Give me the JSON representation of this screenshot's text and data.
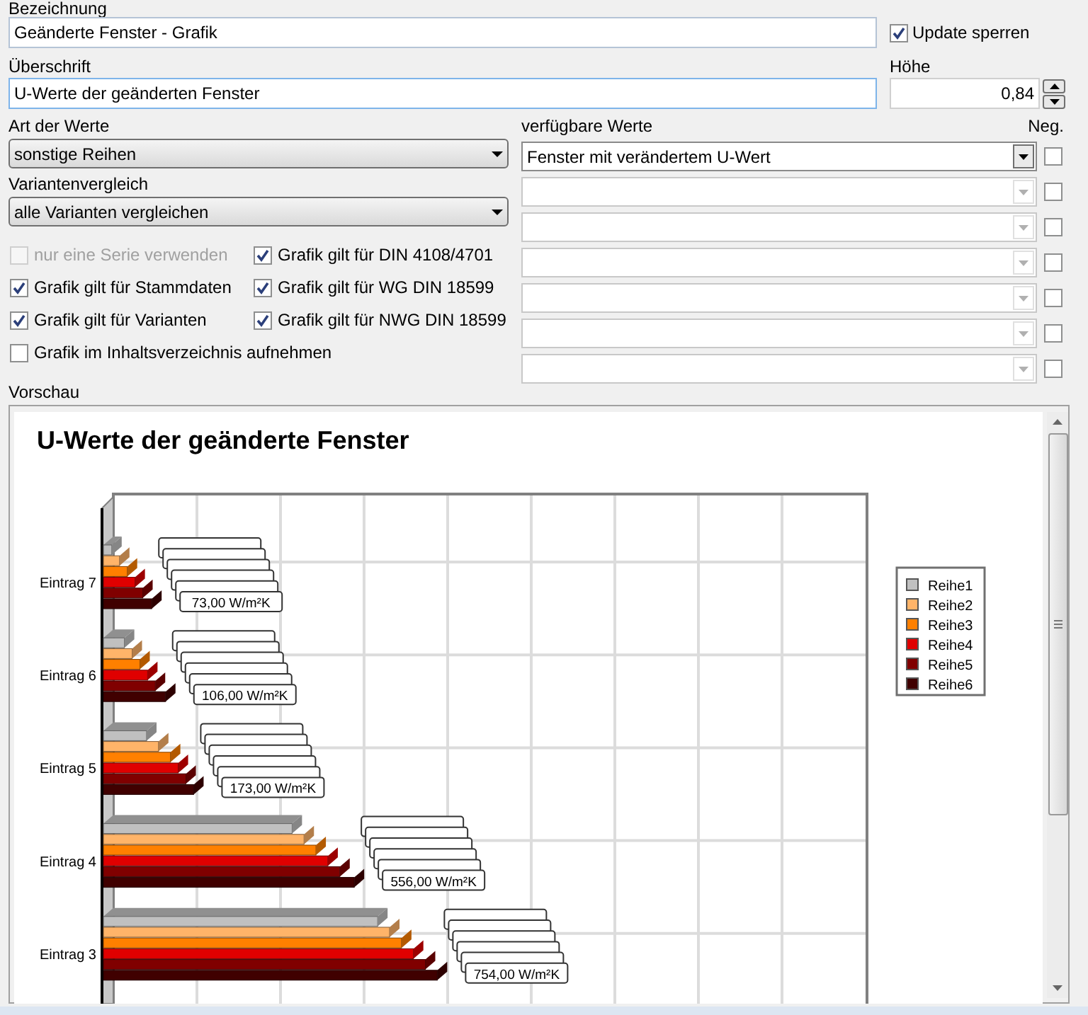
{
  "name": {
    "label": "Bezeichnung",
    "value": "Geänderte Fenster - Grafik"
  },
  "update_lock": {
    "label": "Update sperren",
    "checked": true
  },
  "heading": {
    "label": "Überschrift",
    "value": "U-Werte der geänderten Fenster"
  },
  "height": {
    "label": "Höhe",
    "value": "0,84"
  },
  "value_type": {
    "label": "Art der Werte",
    "value": "sonstige Reihen"
  },
  "variant_compare": {
    "label": "Variantenvergleich",
    "value": "alle Varianten vergleichen"
  },
  "available_values": {
    "label": "verfügbare Werte",
    "neg_label": "Neg.",
    "rows": [
      {
        "value": "Fenster mit verändertem U-Wert",
        "disabled": false,
        "neg": false
      },
      {
        "disabled": true,
        "neg": false
      },
      {
        "disabled": true,
        "neg": false
      },
      {
        "disabled": true,
        "neg": false
      },
      {
        "disabled": true,
        "neg": false
      },
      {
        "disabled": true,
        "neg": false
      },
      {
        "disabled": true,
        "neg": false
      }
    ]
  },
  "options": [
    {
      "label": "nur eine Serie verwenden",
      "checked": false,
      "disabled": true
    },
    {
      "label": "Grafik gilt für DIN 4108/4701",
      "checked": true,
      "disabled": false
    },
    {
      "label": "Grafik gilt für Stammdaten",
      "checked": true,
      "disabled": false
    },
    {
      "label": "Grafik gilt für WG DIN 18599",
      "checked": true,
      "disabled": false
    },
    {
      "label": "Grafik gilt für Varianten",
      "checked": true,
      "disabled": false
    },
    {
      "label": "Grafik gilt für NWG DIN 18599",
      "checked": true,
      "disabled": false
    },
    {
      "label": "Grafik im Inhaltsverzeichnis aufnehmen",
      "checked": false,
      "disabled": false
    }
  ],
  "preview": {
    "label": "Vorschau",
    "chart": {
      "title": "U-Werte der geänderte Fenster",
      "categories": [
        "Eintrag 7",
        "Eintrag 6",
        "Eintrag 5",
        "Eintrag 4",
        "Eintrag 3"
      ],
      "series": [
        {
          "name": "Reihe1",
          "color": "#c0c0c0"
        },
        {
          "name": "Reihe2",
          "color": "#ffb469"
        },
        {
          "name": "Reihe3",
          "color": "#ff8000"
        },
        {
          "name": "Reihe4",
          "color": "#e00000"
        },
        {
          "name": "Reihe5",
          "color": "#800000"
        },
        {
          "name": "Reihe6",
          "color": "#400000"
        }
      ],
      "value_labels": [
        "73,00 W/m²K",
        "106,00 W/m²K",
        "173,00 W/m²K",
        "556,00 W/m²K",
        "754,00 W/m²K"
      ]
    }
  }
}
